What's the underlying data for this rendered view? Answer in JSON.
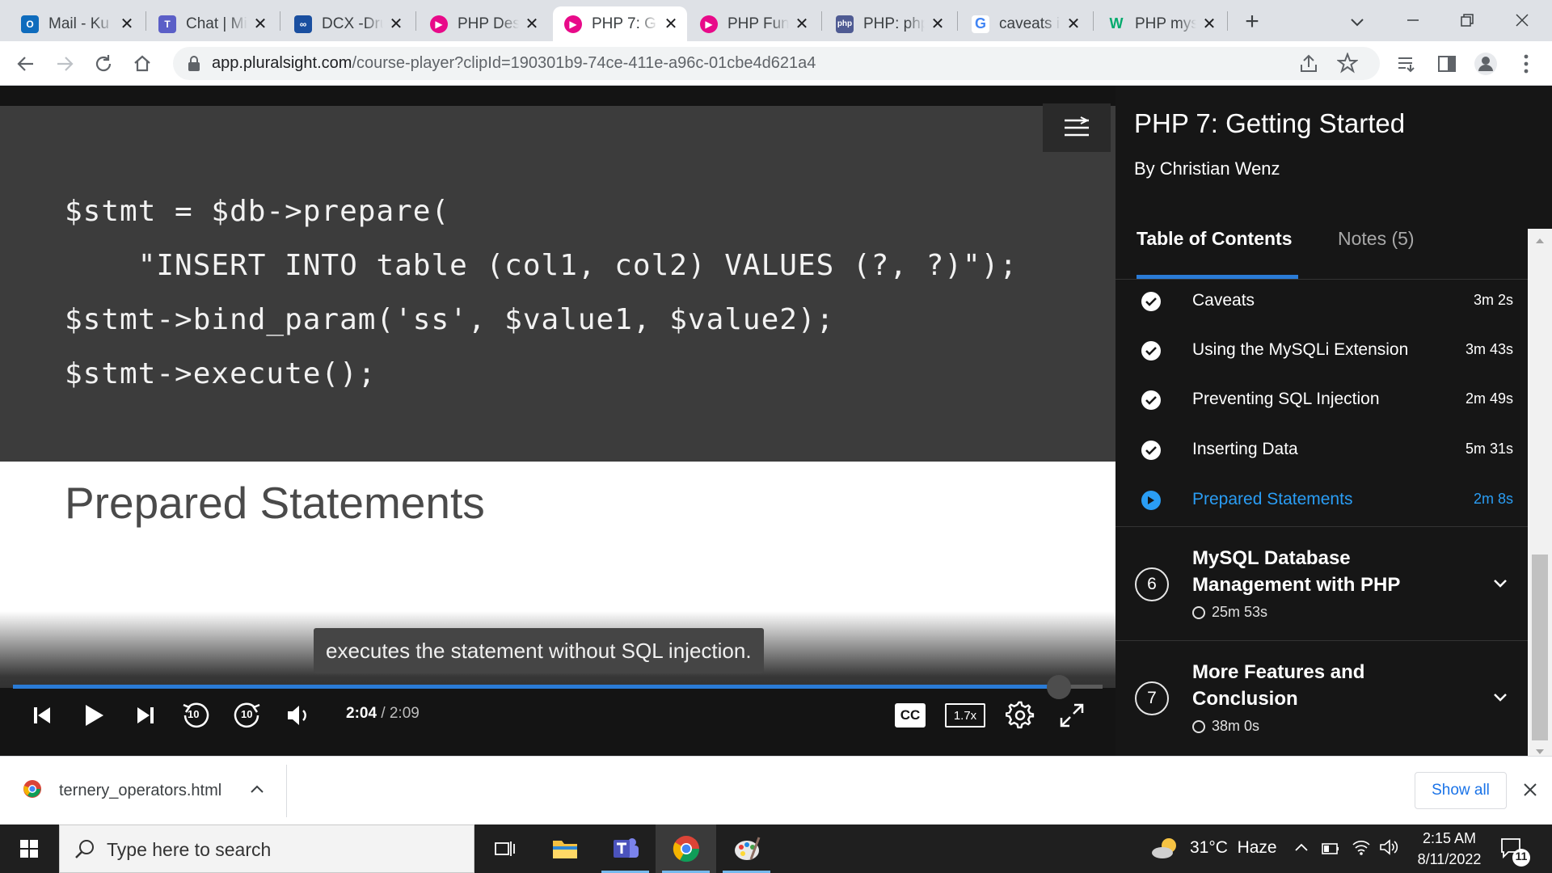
{
  "browser": {
    "tabs": [
      {
        "title": "Mail - Ku",
        "icon": "outlook-icon",
        "color": "#0f6cbd"
      },
      {
        "title": "Chat | Mi",
        "icon": "teams-icon",
        "color": "#5b5fc7"
      },
      {
        "title": "DCX -Dru",
        "icon": "dcx-icon",
        "color": "#1a4fa0"
      },
      {
        "title": "PHP Des",
        "icon": "pluralsight-icon",
        "color": "#e80a89"
      },
      {
        "title": "PHP 7: G",
        "icon": "pluralsight-icon",
        "color": "#e80a89"
      },
      {
        "title": "PHP Fun",
        "icon": "pluralsight-icon",
        "color": "#e80a89"
      },
      {
        "title": "PHP: php",
        "icon": "php-icon",
        "color": "#4f5b93"
      },
      {
        "title": "caveats i",
        "icon": "google-icon",
        "color": "#4285f4"
      },
      {
        "title": "PHP mys",
        "icon": "w3schools-icon",
        "color": "#04aa6d"
      }
    ],
    "url_domain": "app.pluralsight.com",
    "url_path": "/course-player?clipId=190301b9-74ce-411e-a96c-01cbe4d621a4"
  },
  "slide": {
    "code_lines": [
      "$stmt = $db->prepare(",
      "    \"INSERT INTO table (col1, col2) VALUES (?, ?)\");",
      "$stmt->bind_param('ss', $value1, $value2);",
      "$stmt->execute();"
    ],
    "title": "Prepared Statements"
  },
  "player": {
    "caption": "executes the statement without SQL injection.",
    "current_time": "2:04",
    "total_time": "/ 2:09",
    "progress": 0.96,
    "cc_label": "CC",
    "speed_label": "1.7x",
    "skip_back": "10",
    "skip_fwd": "10"
  },
  "sidebar": {
    "course_title": "PHP 7: Getting Started",
    "author": "By Christian Wenz",
    "tab_toc": "Table of Contents",
    "tab_notes": "Notes (5)",
    "clips": [
      {
        "name": "Caveats",
        "duration": "3m 2s",
        "state": "done"
      },
      {
        "name": "Using the MySQLi Extension",
        "duration": "3m 43s",
        "state": "done"
      },
      {
        "name": "Preventing SQL Injection",
        "duration": "2m 49s",
        "state": "done"
      },
      {
        "name": "Inserting Data",
        "duration": "5m 31s",
        "state": "done"
      },
      {
        "name": "Prepared Statements",
        "duration": "2m 8s",
        "state": "current"
      }
    ],
    "modules": [
      {
        "number": "6",
        "title": "MySQL Database Management with PHP",
        "duration": "25m 53s"
      },
      {
        "number": "7",
        "title": "More Features and Conclusion",
        "duration": "38m 0s"
      }
    ]
  },
  "download": {
    "filename": "ternery_operators.html",
    "show_all": "Show all"
  },
  "taskbar": {
    "search_placeholder": "Type here to search",
    "weather": "31°C  Haze",
    "time": "2:15 AM",
    "date": "8/11/2022",
    "notification_count": "11"
  }
}
